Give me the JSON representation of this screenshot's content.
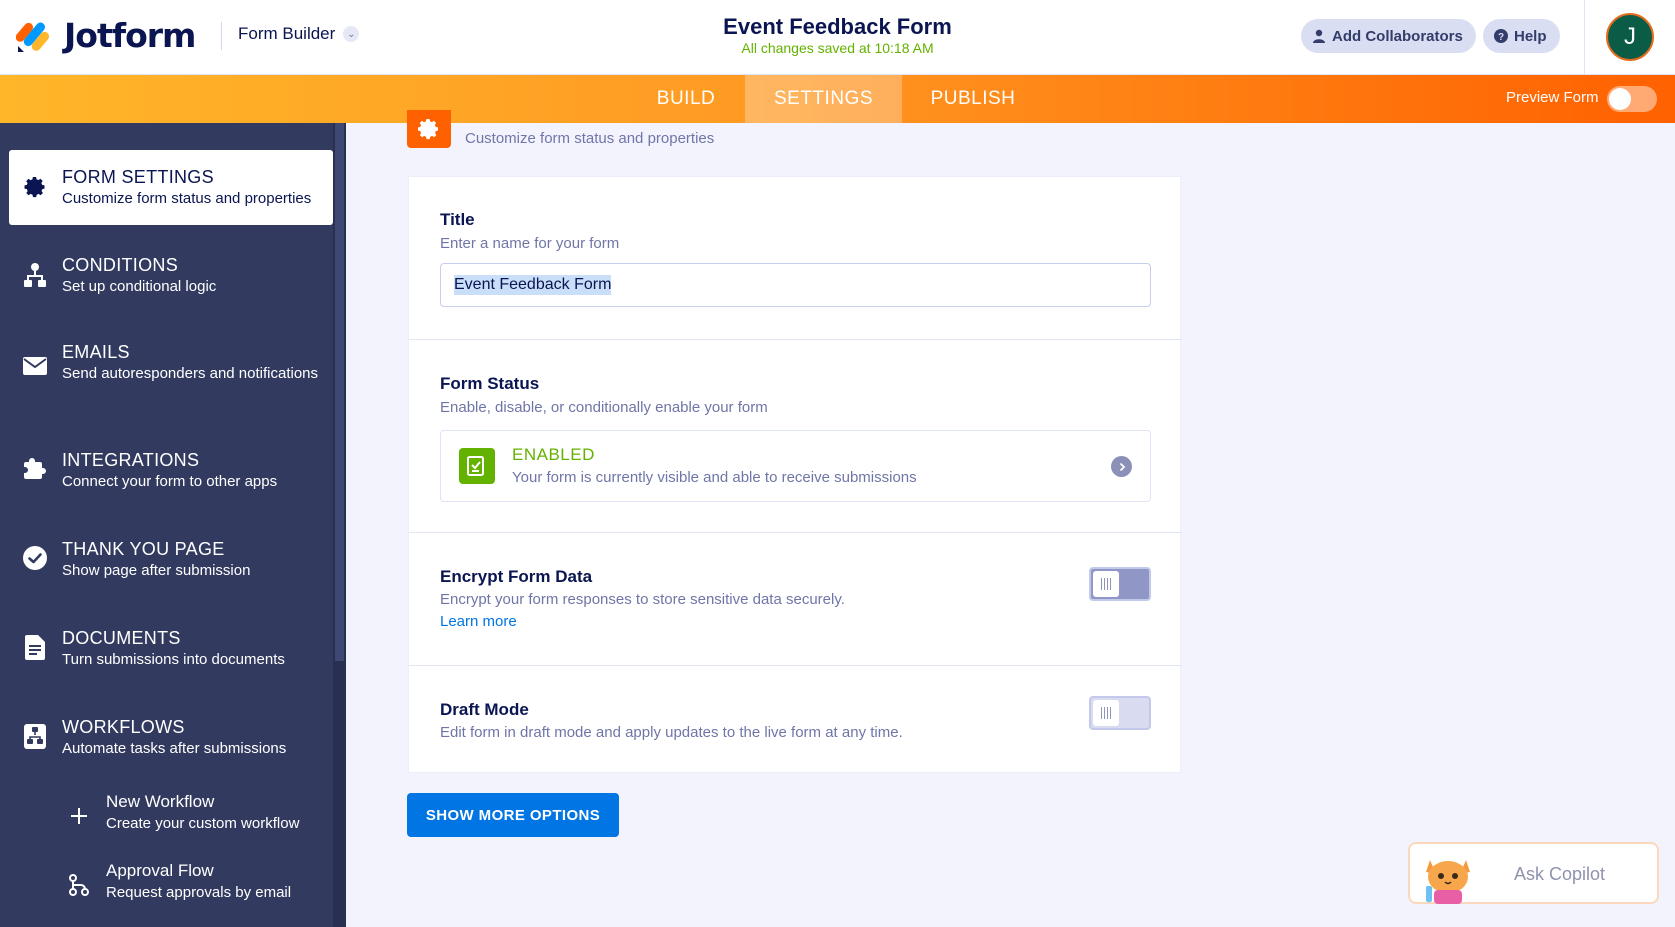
{
  "header": {
    "brand": "Jotform",
    "builder_dropdown": "Form Builder",
    "form_title": "Event Feedback Form",
    "save_status": "All changes saved at 10:18 AM",
    "add_collaborators": "Add Collaborators",
    "help": "Help",
    "avatar_initial": "J"
  },
  "nav": {
    "tabs": [
      {
        "label": "BUILD",
        "active": false
      },
      {
        "label": "SETTINGS",
        "active": true
      },
      {
        "label": "PUBLISH",
        "active": false
      }
    ],
    "preview_label": "Preview Form",
    "preview_on": false
  },
  "sidebar": {
    "items": [
      {
        "title": "FORM SETTINGS",
        "subtitle": "Customize form status and properties",
        "icon": "gear-icon",
        "active": true
      },
      {
        "title": "CONDITIONS",
        "subtitle": "Set up conditional logic",
        "icon": "conditions-icon",
        "active": false
      },
      {
        "title": "EMAILS",
        "subtitle": "Send autoresponders and notifications",
        "icon": "envelope-icon",
        "active": false
      },
      {
        "title": "INTEGRATIONS",
        "subtitle": "Connect your form to other apps",
        "icon": "puzzle-icon",
        "active": false
      },
      {
        "title": "THANK YOU PAGE",
        "subtitle": "Show page after submission",
        "icon": "check-circle-icon",
        "active": false
      },
      {
        "title": "DOCUMENTS",
        "subtitle": "Turn submissions into documents",
        "icon": "document-icon",
        "active": false
      },
      {
        "title": "WORKFLOWS",
        "subtitle": "Automate tasks after submissions",
        "icon": "workflow-icon",
        "active": false
      }
    ],
    "subitems": [
      {
        "title": "New Workflow",
        "subtitle": "Create your custom workflow",
        "icon": "plus-icon"
      },
      {
        "title": "Approval Flow",
        "subtitle": "Request approvals by email",
        "icon": "approval-flow-icon"
      }
    ]
  },
  "main": {
    "header_subtitle": "Customize form status and properties",
    "title_section": {
      "title": "Title",
      "description": "Enter a name for your form",
      "input_value": "Event Feedback Form"
    },
    "status_section": {
      "title": "Form Status",
      "description": "Enable, disable, or conditionally enable your form",
      "status_label": "ENABLED",
      "status_description": "Your form is currently visible and able to receive submissions"
    },
    "encrypt_section": {
      "title": "Encrypt Form Data",
      "description": "Encrypt your form responses to store sensitive data securely.",
      "link": "Learn more",
      "enabled": false
    },
    "draft_section": {
      "title": "Draft Mode",
      "description": "Edit form in draft mode and apply updates to the live form at any time.",
      "enabled": false
    },
    "show_more": "SHOW MORE OPTIONS"
  },
  "copilot": {
    "label": "Ask Copilot"
  },
  "colors": {
    "brand_orange": "#ff6100",
    "sidebar_bg": "#323b5f",
    "enabled_green": "#64b200",
    "primary_blue": "#0075e3",
    "navy_text": "#0a1551"
  }
}
